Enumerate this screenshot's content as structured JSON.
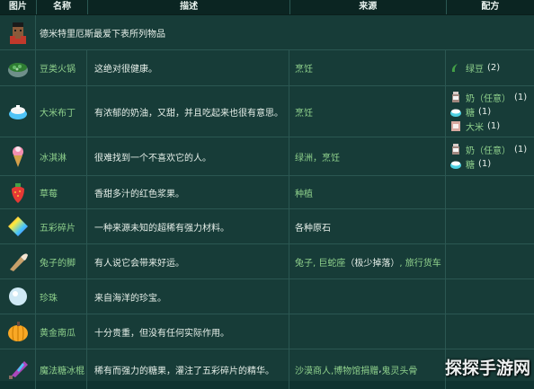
{
  "header": {
    "image_label": "图片",
    "name_label": "名称",
    "desc_label": "描述",
    "source_label": "来源",
    "recipe_label": "配方"
  },
  "intro": {
    "text": "德米特里厄斯最爱下表所列物品",
    "icon": "villager-portrait-icon"
  },
  "rows": [
    {
      "icon": "bean-hotpot-icon",
      "name": "豆类火锅",
      "desc": "这绝对很健康。",
      "source": "烹饪",
      "recipe": [
        {
          "icon": "green-bean-icon",
          "name": "绿豆",
          "qty": "(2)"
        }
      ]
    },
    {
      "icon": "rice-pudding-icon",
      "name": "大米布丁",
      "desc": "有浓郁的奶油，又甜，并且吃起来也很有意思。",
      "source": "烹饪",
      "recipe": [
        {
          "icon": "milk-icon",
          "name": "奶（任意）",
          "qty": "(1)"
        },
        {
          "icon": "sugar-icon",
          "name": "糖",
          "qty": "(1)"
        },
        {
          "icon": "rice-icon",
          "name": "大米",
          "qty": "(1)"
        }
      ]
    },
    {
      "icon": "ice-cream-icon",
      "name": "冰淇淋",
      "desc": "很难找到一个不喜欢它的人。",
      "source": "绿洲，烹饪",
      "recipe": [
        {
          "icon": "milk-icon",
          "name": "奶（任意）",
          "qty": "(1)"
        },
        {
          "icon": "sugar-icon",
          "name": "糖",
          "qty": "(1)"
        }
      ]
    },
    {
      "icon": "strawberry-icon",
      "name": "草莓",
      "desc": "香甜多汁的红色浆果。",
      "source": "种植",
      "recipe": []
    },
    {
      "icon": "prismatic-shard-icon",
      "name": "五彩碎片",
      "desc": "一种来源未知的超稀有强力材料。",
      "source_plain": "各种原石",
      "recipe": []
    },
    {
      "icon": "rabbit-foot-icon",
      "name": "兔子的脚",
      "desc": "有人说它会带来好运。",
      "source_parts": [
        "兔子, 巨蛇座",
        "（极少掉落）",
        ", 旅行货车"
      ],
      "recipe": []
    },
    {
      "icon": "pearl-icon",
      "name": "珍珠",
      "desc": "来自海洋的珍宝。",
      "source": "",
      "recipe": []
    },
    {
      "icon": "golden-pumpkin-icon",
      "name": "黄金南瓜",
      "desc": "十分贵重，但没有任何实际作用。",
      "source": "",
      "recipe": []
    },
    {
      "icon": "magic-rock-candy-icon",
      "name": "魔法糖冰棍",
      "desc": "稀有而强力的糖果，灌注了五彩碎片的精华。",
      "source_parts": [
        "沙漠商人,博物馆捐赠",
        ", ",
        "鬼灵头骨"
      ],
      "recipe": []
    }
  ],
  "watermark": "探探手游网",
  "colors": {
    "background": "#173c38",
    "header": "#0b2522",
    "link": "#8fd18c",
    "text": "#e6efe9"
  }
}
